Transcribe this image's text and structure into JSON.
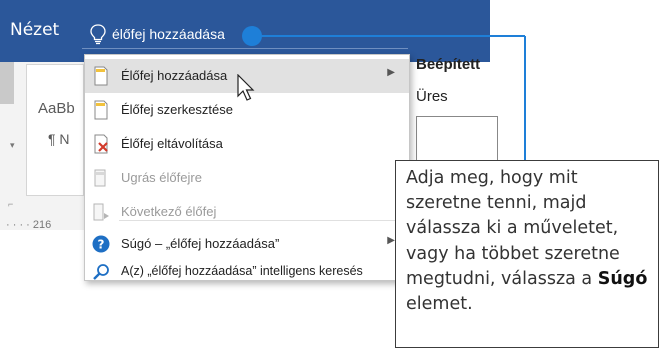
{
  "ribbon": {
    "tab_label": "Nézet"
  },
  "tell_me": {
    "query": "élőfej hozzáadása",
    "icon": "lightbulb-icon"
  },
  "styles_gallery": {
    "preview_1": "AaBb",
    "preview_2": "¶ N"
  },
  "ruler": {
    "number": "216"
  },
  "header_gallery": {
    "section_title": "Beépített",
    "item_empty": "Üres"
  },
  "menu": {
    "items": [
      {
        "label": "Élőfej hozzáadása",
        "icon": "page-header-icon",
        "has_submenu": true,
        "highlighted": true,
        "disabled": false
      },
      {
        "label": "Élőfej szerkesztése",
        "icon": "edit-header-icon",
        "has_submenu": false,
        "highlighted": false,
        "disabled": false
      },
      {
        "label": "Élőfej eltávolítása",
        "icon": "remove-header-icon",
        "has_submenu": false,
        "highlighted": false,
        "disabled": false
      },
      {
        "label": "Ugrás élőfejre",
        "icon": "goto-header-icon",
        "has_submenu": false,
        "highlighted": false,
        "disabled": true
      },
      {
        "label": "Következő élőfej",
        "icon": "next-header-icon",
        "has_submenu": false,
        "highlighted": false,
        "disabled": true
      },
      {
        "label": "Súgó – „élőfej hozzáadása”",
        "icon": "help-icon",
        "has_submenu": true,
        "highlighted": false,
        "disabled": false
      },
      {
        "label": "A(z) „élőfej hozzáadása” intelligens keresés",
        "icon": "smart-lookup-icon",
        "has_submenu": false,
        "highlighted": false,
        "disabled": false
      }
    ]
  },
  "callout": {
    "text_before": "Adja meg, hogy mit szeretne tenni, majd válassza ki a műveletet, vagy ha többet szeretne megtudni, válassza a ",
    "bold_word": "Súgó",
    "text_after": " elemet."
  },
  "colors": {
    "ribbon_blue": "#2b579a",
    "accent_line": "#1e7fd8",
    "help_blue": "#1e6fc4",
    "remove_red": "#d23a2a"
  }
}
